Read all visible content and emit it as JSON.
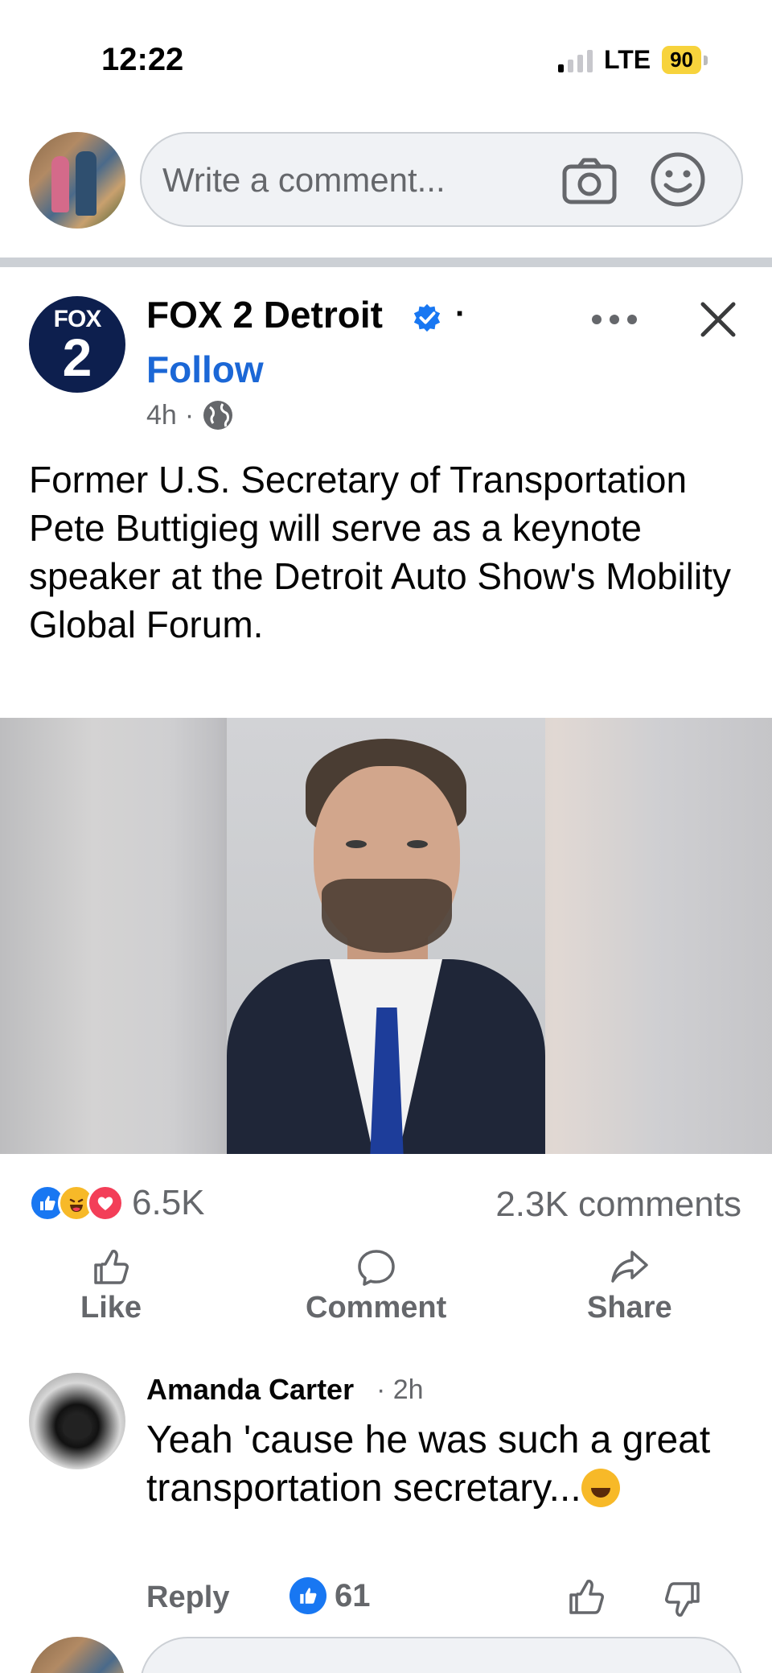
{
  "status_bar": {
    "time": "12:22",
    "network": "LTE",
    "battery": "90"
  },
  "composer": {
    "placeholder": "Write a comment...",
    "camera_icon": "camera-icon",
    "emoji_icon": "smiley-icon"
  },
  "post": {
    "page_name": "FOX 2 Detroit",
    "logo_top": "FOX",
    "logo_number": "2",
    "verified_icon": "verified-badge-icon",
    "separator": "·",
    "follow_label": "Follow",
    "time_ago": "4h",
    "meta_separator": "·",
    "audience_icon": "globe-icon",
    "text": "Former U.S. Secretary of Transportation Pete Buttigieg will serve as a keynote speaker at the Detroit Auto Show's Mobility Global Forum.",
    "reactions": {
      "count": "6.5K",
      "types": [
        "like",
        "haha",
        "love"
      ]
    },
    "comment_count": "2.3K comments",
    "actions": {
      "like": "Like",
      "comment": "Comment",
      "share": "Share"
    }
  },
  "comment": {
    "author": "Amanda Carter",
    "time": "· 2h",
    "text": "Yeah 'cause he was such a great transportation secretary...",
    "emoji": "rolling-on-floor-laughing",
    "reply_label": "Reply",
    "like_count": "61"
  },
  "colors": {
    "accent": "#1b67d6",
    "like_blue": "#1877f2",
    "love_red": "#f33e58",
    "haha_yellow": "#f7b928",
    "muted_text": "#65676b",
    "fox_navy": "#0d1f4e"
  }
}
